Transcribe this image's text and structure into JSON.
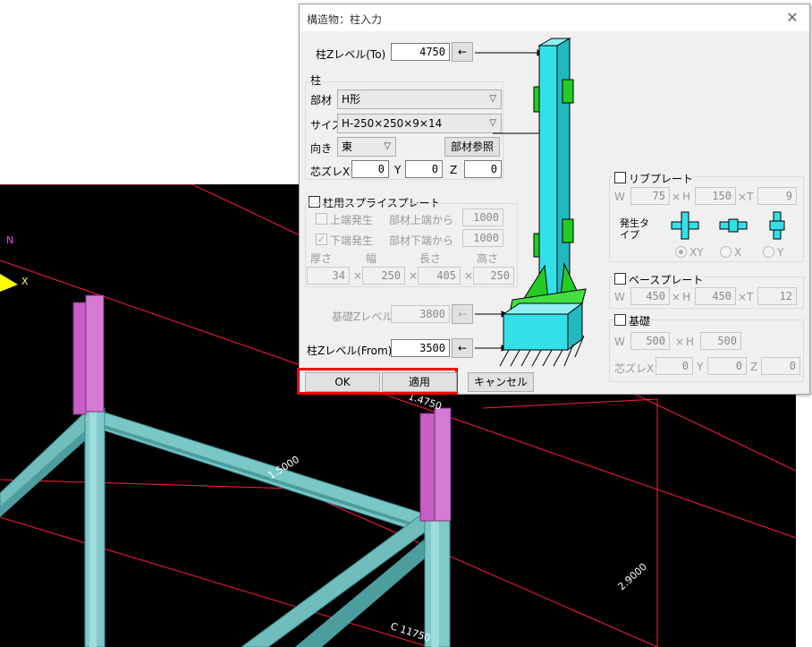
{
  "dialog": {
    "title": "構造物：柱入力",
    "top_level_label": "柱Zレベル(To)",
    "top_level_value": "4750",
    "column_group_label": "柱",
    "member_label": "部材",
    "member_value": "H形",
    "size_label": "サイズ",
    "size_value": "H-250×250×9×14",
    "direction_label": "向き",
    "direction_value": "東",
    "member_ref_label": "部材参照",
    "offset_label": "芯ズレX",
    "offset_x": "0",
    "offset_y_label": "Y",
    "offset_y": "0",
    "offset_z_label": "Z",
    "offset_z": "0",
    "splice_label": "柱用スプライスプレート",
    "upper_label": "上端発生",
    "upper_from_label": "部材上端から",
    "upper_value": "1000",
    "lower_label": "下端発生",
    "lower_from_label": "部材下端から",
    "lower_value": "1000",
    "thick_label": "厚さ",
    "width_label": "幅",
    "length_label": "長さ",
    "height_label": "高さ",
    "thick_value": "34",
    "width_value": "250",
    "length_value": "405",
    "height_value": "250",
    "times": "×",
    "base_level_label": "基礎Zレベル",
    "base_level_value": "3800",
    "bottom_level_label": "柱Zレベル(From)",
    "bottom_level_value": "3500",
    "arrow_glyph": "←",
    "ok_label": "OK",
    "apply_label": "適用",
    "cancel_label": "キャンセル",
    "rib": {
      "label": "リブプレート",
      "w_label": "W",
      "w": "75",
      "h_label": "H",
      "h": "150",
      "t_label": "T",
      "t": "9",
      "gen_label": "発生タイプ",
      "opt_xy": "XY",
      "opt_x": "X",
      "opt_y": "Y"
    },
    "base_plate": {
      "label": "ベースプレート",
      "w_label": "W",
      "w": "450",
      "h_label": "H",
      "h": "450",
      "t_label": "T",
      "t": "12"
    },
    "foundation": {
      "label": "基礎",
      "w_label": "W",
      "w": "500",
      "h_label": "H",
      "h": "500",
      "offset_label": "芯ズレX",
      "x": "0",
      "y_label": "Y",
      "y": "0",
      "z_label": "Z",
      "z": "0"
    }
  },
  "viewport": {
    "axis_n": "N",
    "axis_x": "X",
    "dim_1": "1.4750",
    "dim_2": "1.5000",
    "dim_3": "2.9000",
    "dim_4": "C 11750"
  },
  "colors": {
    "column": "#c75fc7",
    "beam": "#6fbdbd",
    "grid": "#ff1f3a",
    "highlight": "#ff0000",
    "preview_steel": "#33e0e8",
    "preview_plate": "#22cc22"
  }
}
